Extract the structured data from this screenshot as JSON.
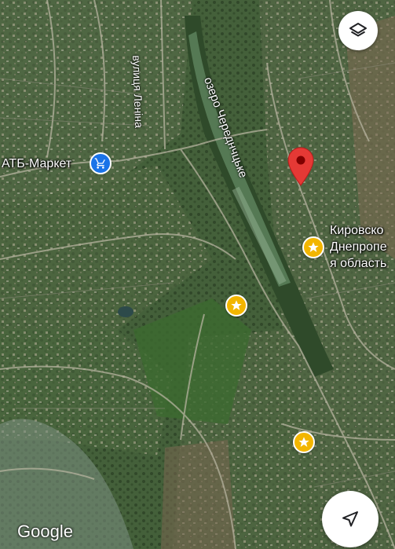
{
  "map": {
    "type": "satellite",
    "labels": {
      "store": "АТБ-Маркет",
      "street": "вулиця Леніна",
      "lake": "озеро Череднчцьке",
      "city_line1": "Кировско",
      "city_line2": "Днепропе",
      "city_line3": "я область"
    },
    "attribution": "Google"
  },
  "controls": {
    "layers_icon": "layers-icon",
    "locate_icon": "navigation-arrow-icon"
  },
  "colors": {
    "store_pin": "#1a73e8",
    "star_pin": "#f2b600",
    "selected_pin": "#e53935"
  }
}
